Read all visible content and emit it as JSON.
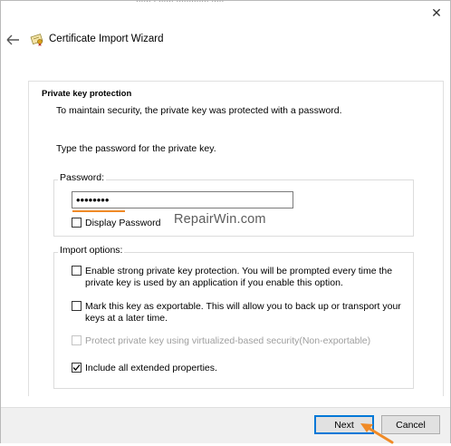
{
  "window": {
    "title": "Certificate Import Wizard",
    "cutoff_text": "...... . ...... ............. .....",
    "close_glyph": "✕",
    "back_glyph": "←"
  },
  "header": {
    "section_title": "Private key protection",
    "section_description": "To maintain security, the private key was protected with a password."
  },
  "body": {
    "prompt": "Type the password for the private key.",
    "password_group": {
      "label": "Password:",
      "value": "••••••••",
      "display_password": {
        "label": "Display Password",
        "checked": false
      }
    },
    "import_group": {
      "label": "Import options:",
      "options": [
        {
          "label": "Enable strong private key protection. You will be prompted every time the private key is used by an application if you enable this option.",
          "line1": "Enable strong private key protection. You will be prompted every time the",
          "line2": "private key is used by an application if you enable this option.",
          "checked": false,
          "enabled": true
        },
        {
          "label": "Mark this key as exportable. This will allow you to back up or transport your keys at a later time.",
          "line1": "Mark this key as exportable. This will allow you to back up or transport your",
          "line2": "keys at a later time.",
          "checked": false,
          "enabled": true
        },
        {
          "label": "Protect private key using virtualized-based security(Non-exportable)",
          "checked": false,
          "enabled": false
        },
        {
          "label": "Include all extended properties.",
          "checked": true,
          "enabled": true
        }
      ]
    },
    "watermark": "RepairWin.com"
  },
  "footer": {
    "next_label": "Next",
    "cancel_label": "Cancel"
  },
  "colors": {
    "accent": "#0078d7",
    "annotation_orange": "#f08a26",
    "footer_bg": "#f0f0f0"
  },
  "icons": [
    "back-arrow-icon",
    "certificate-icon",
    "close-icon",
    "pointer-arrow-icon"
  ]
}
